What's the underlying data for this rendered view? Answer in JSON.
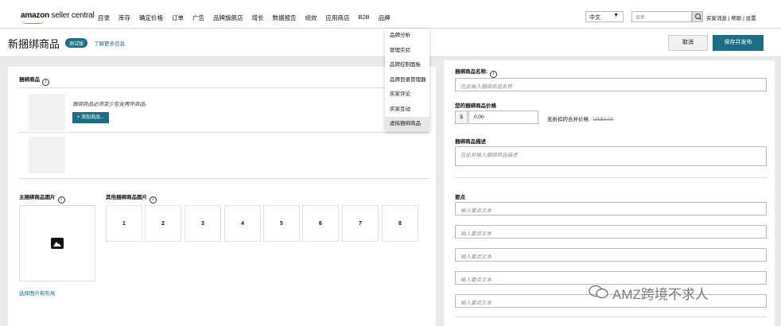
{
  "logo": {
    "brand": "amazon",
    "suffix": "seller central"
  },
  "nav": [
    "目录",
    "库存",
    "确定价格",
    "订单",
    "广告",
    "品牌旗舰店",
    "增长",
    "数据报告",
    "绩效",
    "应用商店",
    "B2B",
    "品牌"
  ],
  "language": {
    "value": "中文"
  },
  "search": {
    "placeholder": "搜索"
  },
  "top_links": "买家消息 | 帮助 | 设置",
  "page": {
    "title": "新捆绑商品",
    "badge": "测试版",
    "learn_more": "了解更多信息"
  },
  "actions": {
    "cancel": "取消",
    "save": "保存并发布"
  },
  "brand_menu": [
    "品牌分析",
    "管理实验",
    "品牌控制面板",
    "品牌目录管理器",
    "买家评论",
    "买家互动",
    "虚拟捆绑商品"
  ],
  "left": {
    "bundle_label": "捆绑商品",
    "hint": "捆绑商品必须至少包含两件商品。",
    "add_button": "+ 添加商品...",
    "main_image_label": "主捆绑商品图片",
    "other_images_label": "其他捆绑商品图片",
    "slots": [
      "1",
      "2",
      "3",
      "4",
      "5",
      "6",
      "7",
      "8"
    ],
    "choose_link": "选择图片和布局"
  },
  "right": {
    "name_label": "捆绑商品名称:",
    "name_placeholder": "在此输入捆绑商品名称",
    "price_label": "您的捆绑商品价格",
    "currency": "$",
    "price_value": "0.00",
    "no_discount_label": "无折扣的合并价格:",
    "no_discount_value": "US$0.00",
    "desc_label": "捆绑商品描述",
    "desc_placeholder": "在此处输入捆绑商品描述",
    "bullets_label": "要点",
    "bullets": [
      "输入要点文本",
      "输入要点文本",
      "输入要点文本",
      "输入要点文本",
      "输入要点文本"
    ]
  },
  "watermark": "AMZ跨境不求人",
  "colors": {
    "accent": "#1b6e86",
    "logo_smile": "#e47911",
    "background": "#e9eaea"
  }
}
